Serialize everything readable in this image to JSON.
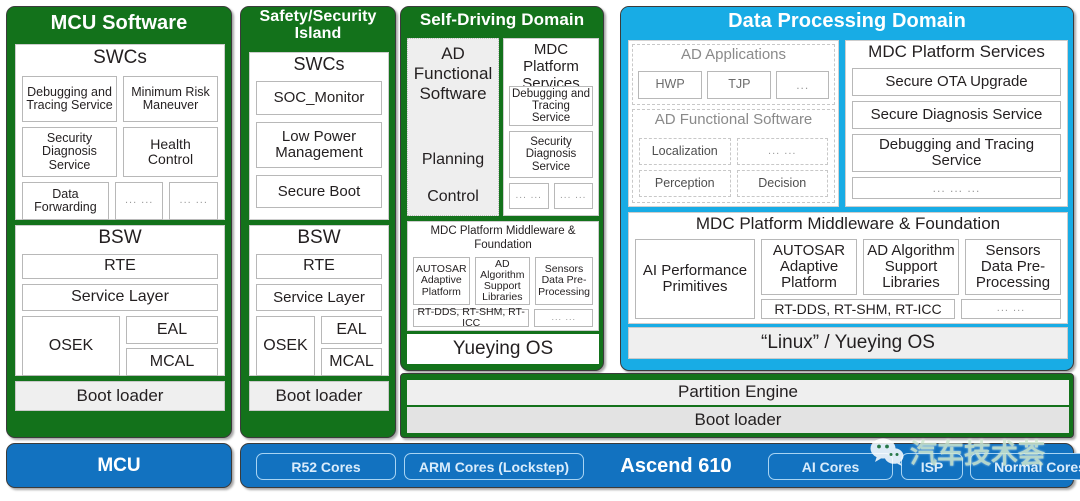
{
  "columns": {
    "mcu_software": {
      "header": "MCU Software",
      "swcs": {
        "title": "SWCs",
        "boxes": [
          "Debugging and Tracing Service",
          "Minimum Risk Maneuver",
          "Security Diagnosis Service",
          "Health Control",
          "Data Forwarding",
          "... ...",
          "... ..."
        ]
      },
      "bsw": {
        "title": "BSW",
        "rte": "RTE",
        "service_layer": "Service Layer",
        "osek": "OSEK",
        "eal": "EAL",
        "mcal": "MCAL"
      },
      "boot_loader": "Boot loader",
      "hardware": "MCU"
    },
    "safety_security_island": {
      "header": "Safety/Security Island",
      "swcs": {
        "title": "SWCs",
        "boxes": [
          "SOC_Monitor",
          "Low Power Management",
          "Secure Boot"
        ]
      },
      "bsw": {
        "title": "BSW",
        "rte": "RTE",
        "service_layer": "Service Layer",
        "osek": "OSEK",
        "eal": "EAL",
        "mcal": "MCAL"
      },
      "boot_loader": "Boot loader"
    },
    "self_driving_domain": {
      "header": "Self-Driving Domain",
      "ad_functional_software": {
        "title": "AD Functional Software",
        "items": [
          "Planning",
          "Control"
        ]
      },
      "mdc_platform_services": {
        "title": "MDC Platform Services",
        "boxes": [
          "Debugging and Tracing Service",
          "Security Diagnosis Service",
          "... ...",
          "... ..."
        ]
      },
      "middleware": {
        "title": "MDC  Platform Middleware & Foundation",
        "boxes": [
          "AUTOSAR Adaptive Platform",
          "AD Algorithm Support Libraries",
          "Sensors Data Pre-Processing"
        ],
        "rt_row": "RT-DDS, RT-SHM, RT-ICC",
        "rt_dots": "... ..."
      },
      "os": "Yueying OS"
    },
    "data_processing_domain": {
      "header": "Data Processing Domain",
      "ad_applications": {
        "title": "AD Applications",
        "boxes": [
          "HWP",
          "TJP",
          "..."
        ]
      },
      "ad_functional_software": {
        "title": "AD Functional Software",
        "boxes": [
          "Localization",
          "... ...",
          "Perception",
          "Decision"
        ]
      },
      "mdc_platform_services": {
        "title": "MDC  Platform Services",
        "boxes": [
          "Secure OTA Upgrade",
          "Secure Diagnosis Service",
          "Debugging and Tracing Service",
          "... ... ..."
        ]
      },
      "middleware": {
        "title": "MDC  Platform Middleware & Foundation",
        "ai_primitives": "AI Performance Primitives",
        "boxes": [
          "AUTOSAR Adaptive Platform",
          "AD Algorithm Support Libraries",
          "Sensors Data Pre-Processing"
        ],
        "rt_row": "RT-DDS, RT-SHM, RT-ICC",
        "rt_dots": "... ..."
      },
      "os": "“Linux” /  Yueying OS"
    }
  },
  "shared_bottom": {
    "partition_engine": "Partition Engine",
    "boot_loader": "Boot loader"
  },
  "hardware_bar": {
    "chips_left": [
      "R52 Cores",
      "ARM Cores (Lockstep)"
    ],
    "soc_label": "Ascend 610",
    "chips_right": [
      "AI Cores",
      "ISP",
      "Normal Cores"
    ]
  },
  "watermark": {
    "text": "汽车技术荟",
    "icon": "wechat-icon"
  },
  "colors": {
    "green": "#13721b",
    "blue_header": "#18ACE5",
    "hardware_blue": "#1272C0",
    "box_border": "#b8b8b8",
    "gray_fill": "#efefef"
  }
}
